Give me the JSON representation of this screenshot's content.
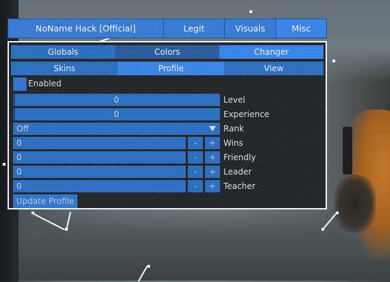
{
  "menu": {
    "title": "NoName Hack [Official]",
    "tabs": [
      "Legit",
      "Visuals",
      "Misc"
    ],
    "active_tab": "Misc"
  },
  "subtabs_row1": {
    "items": [
      "Globals",
      "Colors",
      "Changer"
    ],
    "active": "Changer"
  },
  "subtabs_row2": {
    "items": [
      "Skins",
      "Profile",
      "View"
    ],
    "active": "Profile"
  },
  "profile": {
    "enabled_label": "Enabled",
    "level": {
      "value": "0",
      "label": "Level"
    },
    "experience": {
      "value": "0",
      "label": "Experience"
    },
    "rank": {
      "value": "Off",
      "label": "Rank"
    },
    "wins": {
      "value": "0",
      "label": "Wins"
    },
    "friendly": {
      "value": "0",
      "label": "Friendly"
    },
    "leader": {
      "value": "0",
      "label": "Leader"
    },
    "teacher": {
      "value": "0",
      "label": "Teacher"
    },
    "minus": "-",
    "plus": "+",
    "update_button": "Update Profile"
  },
  "colors": {
    "accent": "#3a7bd5",
    "accent_active": "#3d86e6",
    "panel_bg": "#27292c"
  }
}
